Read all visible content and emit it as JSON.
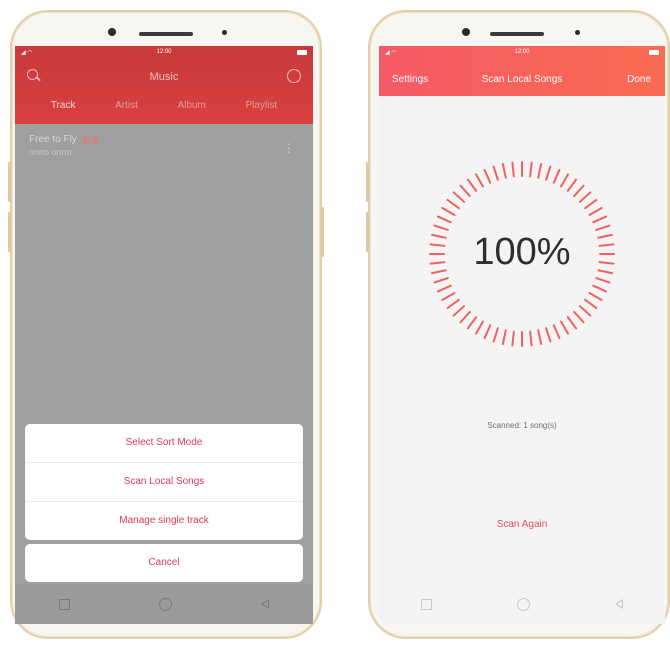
{
  "left_screen": {
    "status_time": "12:00",
    "header_title": "Music",
    "tabs": [
      {
        "label": "Track",
        "active": true
      },
      {
        "label": "Artist",
        "active": false
      },
      {
        "label": "Album",
        "active": false
      },
      {
        "label": "Playlist",
        "active": false
      }
    ],
    "track": {
      "title": "Free to Fly",
      "artist": "onno onno"
    },
    "sheet_options": [
      "Select Sort Mode",
      "Scan Local Songs",
      "Manage single track"
    ],
    "cancel_label": "Cancel"
  },
  "right_screen": {
    "status_time": "12:00",
    "settings_label": "Settings",
    "header_title": "Scan Local Songs",
    "done_label": "Done",
    "progress_percent": 100,
    "progress_text": "100%",
    "scanned_text": "Scanned: 1 song(s)",
    "scan_again_label": "Scan Again"
  },
  "colors": {
    "left_header": "#c83a3c",
    "right_header_start": "#f45a66",
    "right_header_end": "#fa6b51",
    "accent_text": "#e2385a",
    "ring_tick": "#f0625e"
  },
  "icons": {
    "left_header_left": "search-icon",
    "left_header_right": "more-icon",
    "track_indicator": "equalizer-icon",
    "track_menu": "kebab-menu-icon",
    "nav_buttons": [
      "recent-apps-icon",
      "home-icon",
      "back-icon"
    ]
  }
}
